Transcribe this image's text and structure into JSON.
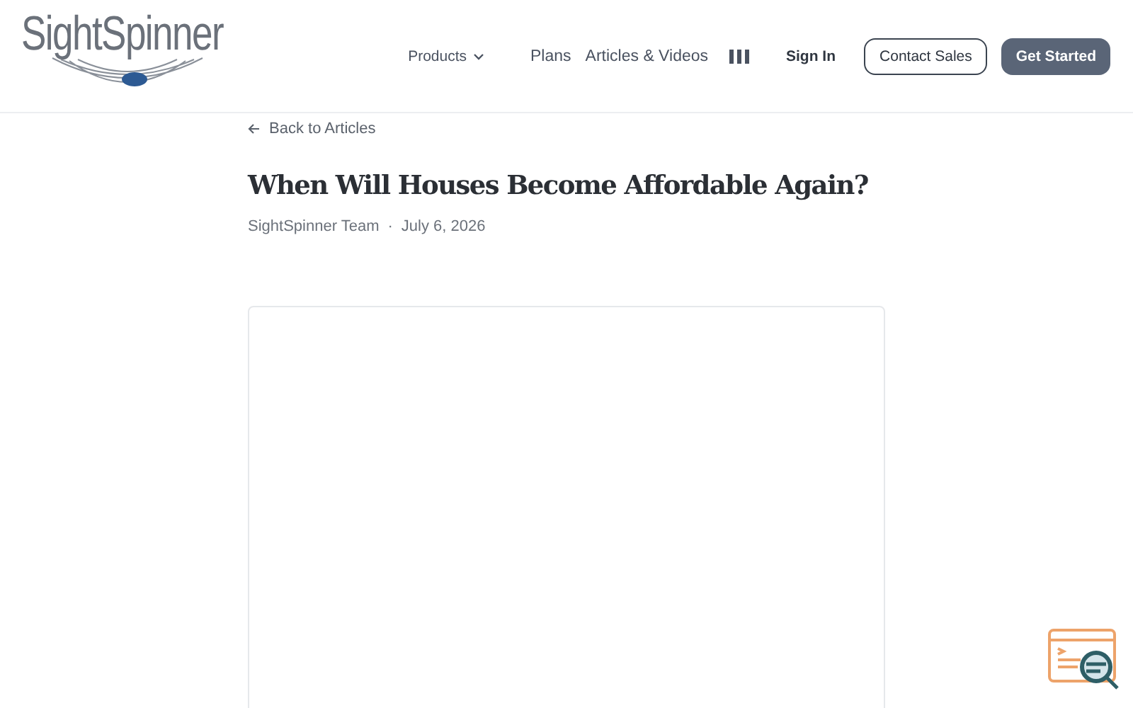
{
  "header": {
    "logo": "SightSpinner",
    "nav": [
      {
        "label": "Products",
        "kind": "dropdown"
      },
      {
        "label": "Plans",
        "kind": "link"
      },
      {
        "label": "Articles & Videos",
        "kind": "link"
      },
      {
        "kind": "bars"
      }
    ],
    "sign_in": "Sign In",
    "contact": "Contact Sales",
    "cta": "Get Started"
  },
  "article": {
    "back": "Back to Articles",
    "title": "When Will Houses Become Affordable Again?",
    "author": "SightSpinner Team",
    "separator": "·",
    "date": "July 6, 2026"
  }
}
